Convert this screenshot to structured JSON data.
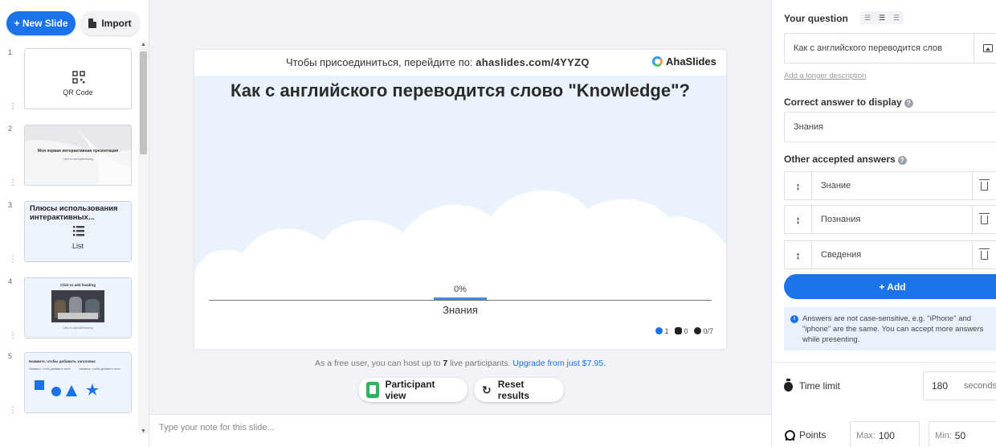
{
  "sidebar": {
    "new_slide_label": "+ New Slide",
    "import_label": "Import",
    "slides": [
      {
        "num": "1",
        "label": "QR Code"
      },
      {
        "num": "2",
        "title": "Моя первая интерактивная презентация",
        "subtitle": "Click to add subheading"
      },
      {
        "num": "3",
        "title": "Плюсы использования интерактивных...",
        "label": "List"
      },
      {
        "num": "4",
        "title": "Click to add heading",
        "subtitle": "Click to add subheading"
      },
      {
        "num": "5",
        "title": "Нажмите, чтобы добавить заголовок",
        "left_text": "Нажмите, чтобы добавить текст",
        "right_text": "Нажмите, чтобы добавить текст"
      }
    ]
  },
  "stage": {
    "join_prefix": "Чтобы присоединиться, перейдите по:",
    "join_code": "ahaslides.com/4YYZQ",
    "brand": "AhaSlides",
    "title": "Как с английского переводится слово \"Knowledge\"?",
    "result_percent": "0%",
    "result_label": "Знания",
    "result_fraction": 0,
    "stats": {
      "participants": "1",
      "reactions": "0",
      "responses": "0/7"
    },
    "free_note_before": "As a free user, you can host up to",
    "free_note_count": "7",
    "free_note_after": "live participants.",
    "upgrade_link": "Upgrade from just $7.95.",
    "participant_view_label": "Participant view",
    "reset_results_label": "Reset results",
    "notes_placeholder": "Type your note for this slide..."
  },
  "panel": {
    "your_question_label": "Your question",
    "question_value": "Как с английского переводится слов",
    "longer_description_link": "Add a longer description",
    "correct_answer_label": "Correct answer to display",
    "correct_answer_value": "Знания",
    "other_answers_label": "Other accepted answers",
    "other_answers": [
      "Знание",
      "Познания",
      "Сведения"
    ],
    "add_label": "+ Add",
    "info_text": "Answers are not case-sensitive, e.g. \"iPhone\" and \"iphone\" are the same. You can accept more answers while presenting.",
    "time_limit_label": "Time limit",
    "time_limit_value": "180",
    "time_limit_unit": "seconds",
    "points_label": "Points",
    "points_max_label": "Max:",
    "points_max_value": "100",
    "points_min_label": "Min:",
    "points_min_value": "50"
  },
  "colors": {
    "accent": "#1a73e8",
    "stage_bg": "#eaf3fc",
    "green": "#2fb360"
  }
}
